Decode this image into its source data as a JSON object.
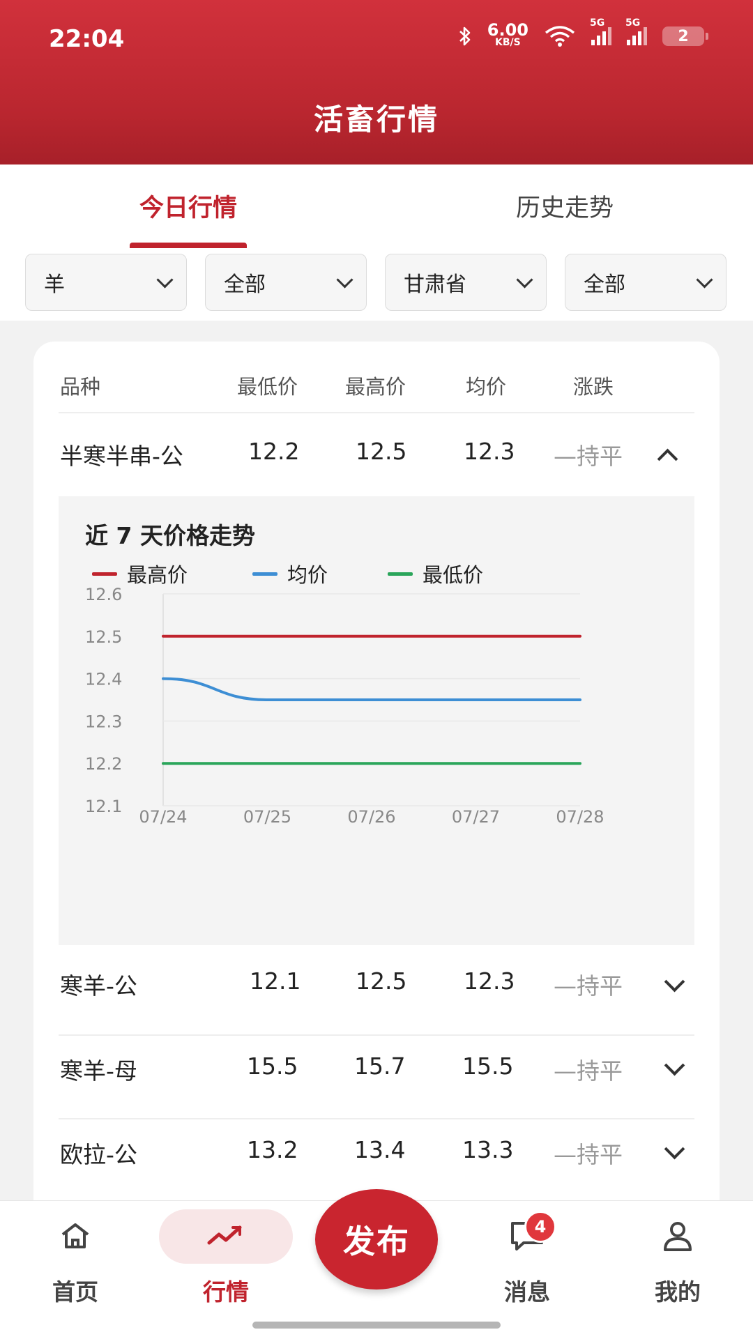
{
  "status_bar": {
    "time": "22:04",
    "net_speed": "6.00",
    "net_unit": "KB/S",
    "sig1": "5G",
    "sig2": "5G",
    "battery": "2"
  },
  "header": {
    "title": "活畜行情"
  },
  "tabs": [
    {
      "label": "今日行情",
      "active": true
    },
    {
      "label": "历史走势",
      "active": false
    }
  ],
  "filters": [
    {
      "value": "羊"
    },
    {
      "value": "全部"
    },
    {
      "value": "甘肃省"
    },
    {
      "value": "全部"
    }
  ],
  "table": {
    "headers": [
      "品种",
      "最低价",
      "最高价",
      "均价",
      "涨跌"
    ],
    "rows": [
      {
        "name": "半寒半串-公",
        "min": "12.2",
        "max": "12.5",
        "avg": "12.3",
        "trend": "—持平",
        "expanded": true
      },
      {
        "name": "寒羊-公",
        "min": "12.1",
        "max": "12.5",
        "avg": "12.3",
        "trend": "—持平",
        "expanded": false
      },
      {
        "name": "寒羊-母",
        "min": "15.5",
        "max": "15.7",
        "avg": "15.5",
        "trend": "—持平",
        "expanded": false
      },
      {
        "name": "欧拉-公",
        "min": "13.2",
        "max": "13.4",
        "avg": "13.3",
        "trend": "—持平",
        "expanded": false
      }
    ]
  },
  "chart": {
    "title": "近 7 天价格走势",
    "legend": [
      "最高价",
      "均价",
      "最低价"
    ]
  },
  "chart_data": {
    "type": "line",
    "title": "近 7 天价格走势",
    "x": [
      "07/24",
      "07/25",
      "07/26",
      "07/27",
      "07/28"
    ],
    "series": [
      {
        "name": "最高价",
        "color": "#c0232d",
        "values": [
          12.5,
          12.5,
          12.5,
          12.5,
          12.5
        ]
      },
      {
        "name": "均价",
        "color": "#3d8ed4",
        "values": [
          12.4,
          12.35,
          12.35,
          12.35,
          12.35
        ]
      },
      {
        "name": "最低价",
        "color": "#2aa55a",
        "values": [
          12.2,
          12.2,
          12.2,
          12.2,
          12.2
        ]
      }
    ],
    "ylim": [
      12.1,
      12.6
    ],
    "yticks": [
      "12.6",
      "12.5",
      "12.4",
      "12.3",
      "12.2",
      "12.1"
    ],
    "grid": true,
    "legend_position": "top-left"
  },
  "publish_label": "发布",
  "nav": {
    "home": "首页",
    "market": "行情",
    "messages": "消息",
    "mine": "我的",
    "message_badge": "4"
  },
  "colors": {
    "brand": "#c0232d",
    "accent_blue": "#3d8ed4",
    "accent_green": "#2aa55a"
  },
  "icons": [
    "bluetooth-icon",
    "wifi-icon",
    "signal-icon",
    "battery-icon",
    "chevron-down-icon",
    "chevron-up-icon",
    "home-icon",
    "trend-icon",
    "message-icon",
    "user-icon"
  ]
}
